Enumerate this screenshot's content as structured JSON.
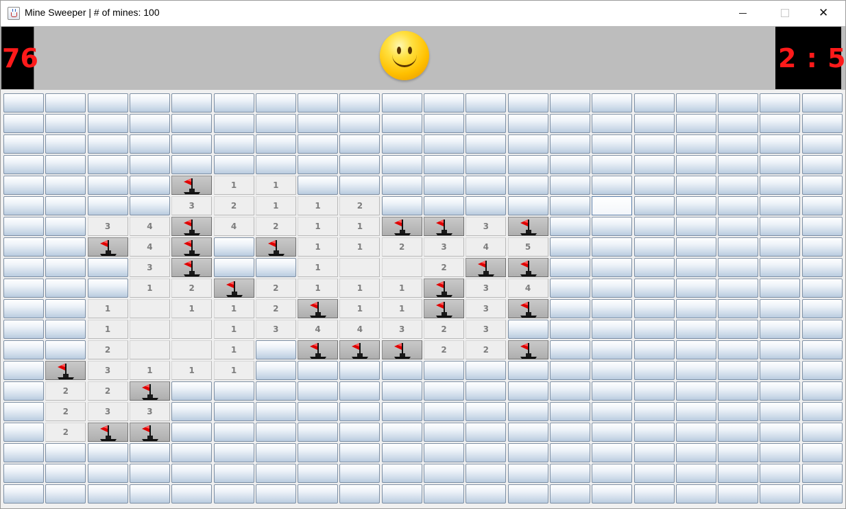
{
  "window": {
    "title": "Mine Sweeper | # of mines: 100",
    "controls": {
      "minimize": "—",
      "maximize": "☐",
      "close": "✕"
    }
  },
  "header": {
    "mines_remaining": "76",
    "timer": "2 : 5",
    "face": "smiley-face"
  },
  "colors": {
    "counter_bg": "#000000",
    "counter_text": "#ff1a1a",
    "header_bg": "#bdbdbd",
    "open_cell_bg": "#eeeeee",
    "flag": "#e00000"
  },
  "board": {
    "rows": 20,
    "cols": 20,
    "legend": {
      "H": "hidden",
      "F": "flagged",
      "0": "open-empty",
      "1-8": "open-number"
    },
    "selected_cell": {
      "row": 5,
      "col": 14
    },
    "cells": [
      "HHHHHHHHHHHHHHHHHHHH",
      "HHHHHHHHHHHHHHHHHHHH",
      "HHHHHHHHHHHHHHHHHHHH",
      "HHHHHHHHHHHHHHHHHHHH",
      "HHHHF11HHHHHHHHHHHHH",
      "HHHH32112HHHHHHHHHHH",
      "HH34F4211FF3FHHHHHHH",
      "HHF4FHF112345HHHHHHH",
      "HHH3FHH1002FFHHHHHHH",
      "HHH12F2111F34HHHHHHH",
      "HH10112F11F3FHHHHHHH",
      "HH1001344323HHHHHHHH",
      "HH2001HFFF22FHHHHHHH",
      "HF3111HHHHHHHHHHHHHH",
      "H22FHHHHHHHHHHHHHHHH",
      "H233HHHHHHHHHHHHHHHH",
      "H2FFHHHHHHHHHHHHHHHH",
      "HHHHHHHHHHHHHHHHHHHH",
      "HHHHHHHHHHHHHHHHHHHH",
      "HHHHHHHHHHHHHHHHHHHH"
    ]
  }
}
